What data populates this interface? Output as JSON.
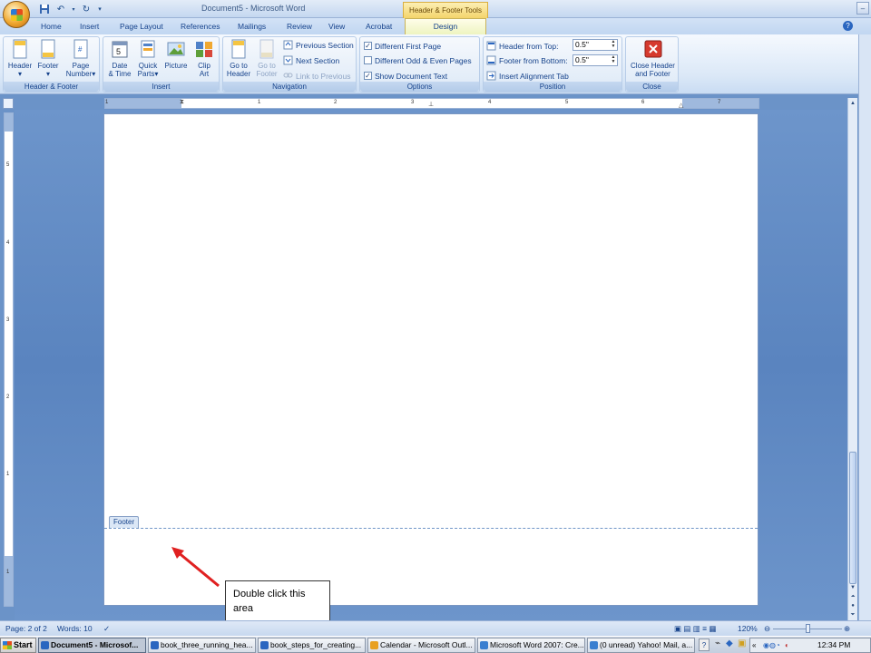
{
  "window": {
    "doc_title": "Document5 - Microsoft Word",
    "context_tools": "Header & Footer Tools"
  },
  "tabs": [
    "Home",
    "Insert",
    "Page Layout",
    "References",
    "Mailings",
    "Review",
    "View",
    "Acrobat",
    "Design"
  ],
  "ribbon": {
    "header_footer": {
      "label": "Header & Footer",
      "header": "Header",
      "footer": "Footer",
      "page_number_1": "Page",
      "page_number_2": "Number"
    },
    "insert": {
      "label": "Insert",
      "date_time_1": "Date",
      "date_time_2": "& Time",
      "quick_parts_1": "Quick",
      "quick_parts_2": "Parts",
      "picture": "Picture",
      "clip_art_1": "Clip",
      "clip_art_2": "Art"
    },
    "navigation": {
      "label": "Navigation",
      "go_header_1": "Go to",
      "go_header_2": "Header",
      "go_footer_1": "Go to",
      "go_footer_2": "Footer",
      "previous_section": "Previous Section",
      "next_section": "Next Section",
      "link_previous": "Link to Previous"
    },
    "options": {
      "label": "Options",
      "diff_first": "Different First Page",
      "diff_odd_even": "Different Odd & Even Pages",
      "show_doc_text": "Show Document Text"
    },
    "position": {
      "label": "Position",
      "header_from_top": "Header from Top:",
      "header_value": "0.5\"",
      "footer_from_bottom": "Footer from Bottom:",
      "footer_value": "0.5\"",
      "insert_alignment_tab": "Insert Alignment Tab"
    },
    "close": {
      "label": "Close",
      "close_1": "Close Header",
      "close_2": "and Footer"
    }
  },
  "ruler_numbers": [
    "1",
    "1",
    "2",
    "3",
    "4",
    "5",
    "6",
    "7"
  ],
  "vruler_numbers": [
    "5",
    "4",
    "3",
    "2",
    "1",
    "1"
  ],
  "document": {
    "footer_tag": "Footer"
  },
  "callout": "Double click this area",
  "status": {
    "page": "Page: 2 of 2",
    "words": "Words: 10",
    "zoom": "120%"
  },
  "taskbar": {
    "start": "Start",
    "tasks": [
      "Document5 - Microsof...",
      "book_three_running_hea...",
      "book_steps_for_creating...",
      "Calendar - Microsoft Outl...",
      "Microsoft Word 2007: Cre...",
      "(0 unread) Yahoo! Mail, a..."
    ],
    "time": "12:34 PM",
    "help": "?"
  },
  "colors": {
    "accent": "#15428b",
    "workspace": "#6b93c8",
    "arrow": "#e02020"
  }
}
